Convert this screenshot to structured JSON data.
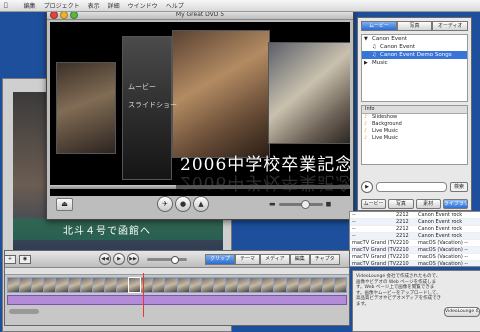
{
  "menubar": {
    "apple": "",
    "items": [
      "",
      "編集",
      "プロジェクト",
      "表示",
      "詳細",
      "ウインドウ",
      "ヘルプ"
    ]
  },
  "main_window": {
    "title": "My Great DVD 5"
  },
  "stage": {
    "menu_labels": [
      "ムービー",
      "スライドショー"
    ],
    "title_text": "2006中学校卒業記念"
  },
  "background_video": {
    "caption": "北斗４号で函館へ"
  },
  "player": {
    "progress_fraction": 0.42,
    "volume_fraction": 0.6
  },
  "right_panel": {
    "tabs": [
      {
        "label": "ムービー",
        "active": true
      },
      {
        "label": "写真",
        "active": false
      },
      {
        "label": "オーディオ",
        "active": false
      }
    ],
    "tree": [
      {
        "label": "Canon Event",
        "level": 1,
        "selected": false
      },
      {
        "label": "Canon Event",
        "level": 2,
        "selected": false
      },
      {
        "label": "Canon Event Demo Songs",
        "level": 2,
        "selected": true
      },
      {
        "label": "Music",
        "level": 1,
        "selected": false
      }
    ],
    "list_header": "Info",
    "files": [
      "Slideshow",
      "Background",
      "Live Music",
      "Live Music"
    ],
    "search_button": "検索",
    "buttons": [
      {
        "label": "ムービー",
        "active": false
      },
      {
        "label": "写真",
        "active": false
      },
      {
        "label": "素材",
        "active": false
      },
      {
        "label": "ライブラリ",
        "active": true
      }
    ]
  },
  "table_window": {
    "rows": [
      [
        "2212",
        "Canon Event",
        "rock"
      ],
      [
        "2212",
        "Canon Event",
        "rock"
      ],
      [
        "2212",
        "Canon Event",
        "rock"
      ],
      [
        "2212",
        "Canon Event",
        "rock"
      ],
      [
        "2210",
        "macOS (Vacation)",
        "--"
      ],
      [
        "2210",
        "macOS (Vacation)",
        "--"
      ],
      [
        "2210",
        "macOS (Vacation)",
        "--"
      ],
      [
        "2210",
        "macOS (Vacation)",
        "--"
      ]
    ],
    "row_prefix": [
      "--",
      "--",
      "--",
      "--",
      "macTV Grand (TV) ...",
      "macTV Grand (TV) ...",
      "macTV Grand (TV) ...",
      "macTV Grand (TV) ..."
    ]
  },
  "timeline": {
    "mode_tabs": [
      {
        "label": "クリップ",
        "active": true
      },
      {
        "label": "テーマ",
        "active": false
      },
      {
        "label": "メディア",
        "active": false
      },
      {
        "label": "編集",
        "active": false
      },
      {
        "label": "チャプタ",
        "active": false
      }
    ],
    "clip_count": 28,
    "selected_clip": 10,
    "zoom_fraction": 0.7
  },
  "info_panel": {
    "text": "VideoLounge 会社で作成されたもので、画像やビデオの Web ページを作成します。Web ページ上で画像を閲覧できます。画像やムービーをアップロードして、高品質ビデオやビデオメディアを作成できます。",
    "button_label": "VideoLounge のホームページへ"
  },
  "colors": {
    "desktop": "#1d4f9c",
    "selection": "#3875d7",
    "timeline_track": "#8fa0c8",
    "audio_track": "#b48bd8"
  }
}
